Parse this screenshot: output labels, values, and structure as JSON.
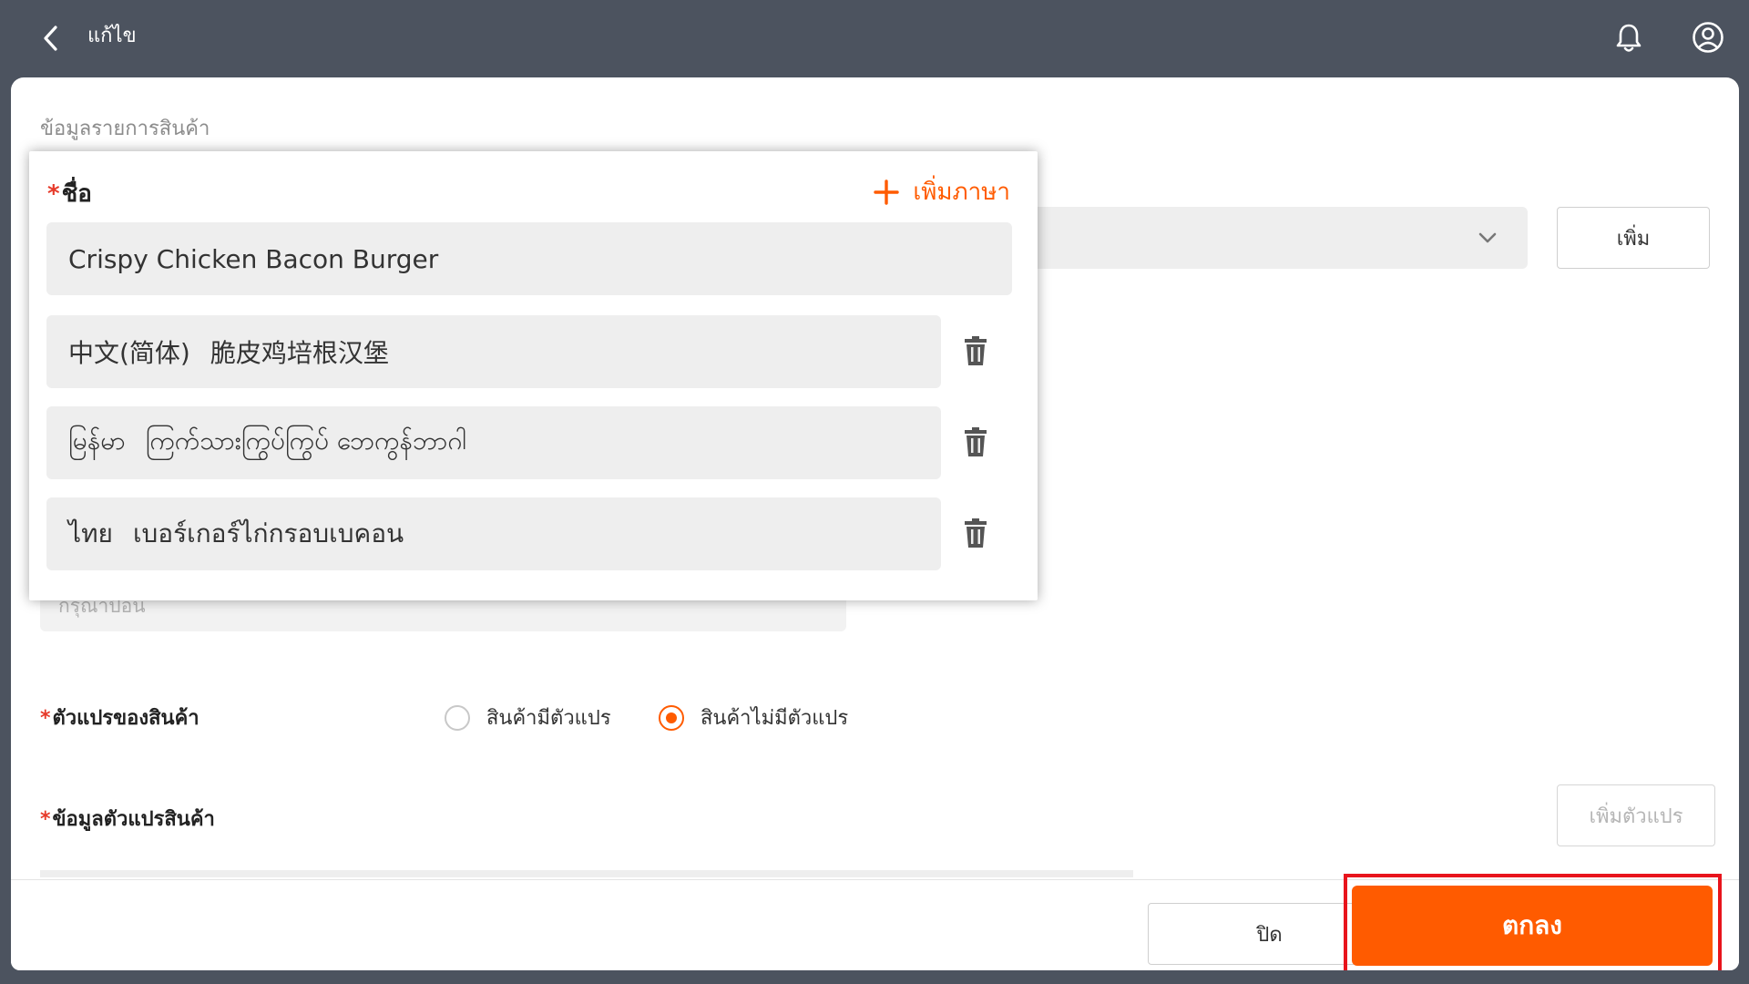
{
  "header": {
    "title": "แก้ไข",
    "back_icon": "chevron-left-icon",
    "notification_icon": "bell-icon",
    "user_icon": "user-circle-icon"
  },
  "form": {
    "section_title": "ข้อมูลรายการสินค้า",
    "add_button": "เพิ่ม",
    "placeholder": "กรุณาป้อน",
    "variant_label": "ตัวแปรของสินค้า",
    "variant_options": [
      {
        "label": "สินค้ามีตัวแปร",
        "selected": false
      },
      {
        "label": "สินค้าไม่มีตัวแปร",
        "selected": true
      }
    ],
    "variant_info_label": "ข้อมูลตัวแปรสินค้า",
    "add_variant_button": "เพิ่มตัวแปร",
    "required_mark": "*"
  },
  "popup": {
    "title": "ชื่อ",
    "add_language": "เพิ่มภาษา",
    "name_value": "Crispy Chicken Bacon Burger",
    "translations": [
      {
        "language": "中文(简体)",
        "value": "脆皮鸡培根汉堡"
      },
      {
        "language": "မြန်မာ",
        "value": "ကြက်သားကြွပ်ကြွပ် ဘေကွန်ဘာဂါ"
      },
      {
        "language": "ไทย",
        "value": "เบอร์เกอร์ไก่กรอบเบคอน"
      }
    ]
  },
  "footer": {
    "close_button": "ปิด",
    "confirm_button": "ตกลง"
  },
  "colors": {
    "accent": "#ff5b00",
    "header_bg": "#4c535f",
    "highlight_border": "#e8141c"
  }
}
